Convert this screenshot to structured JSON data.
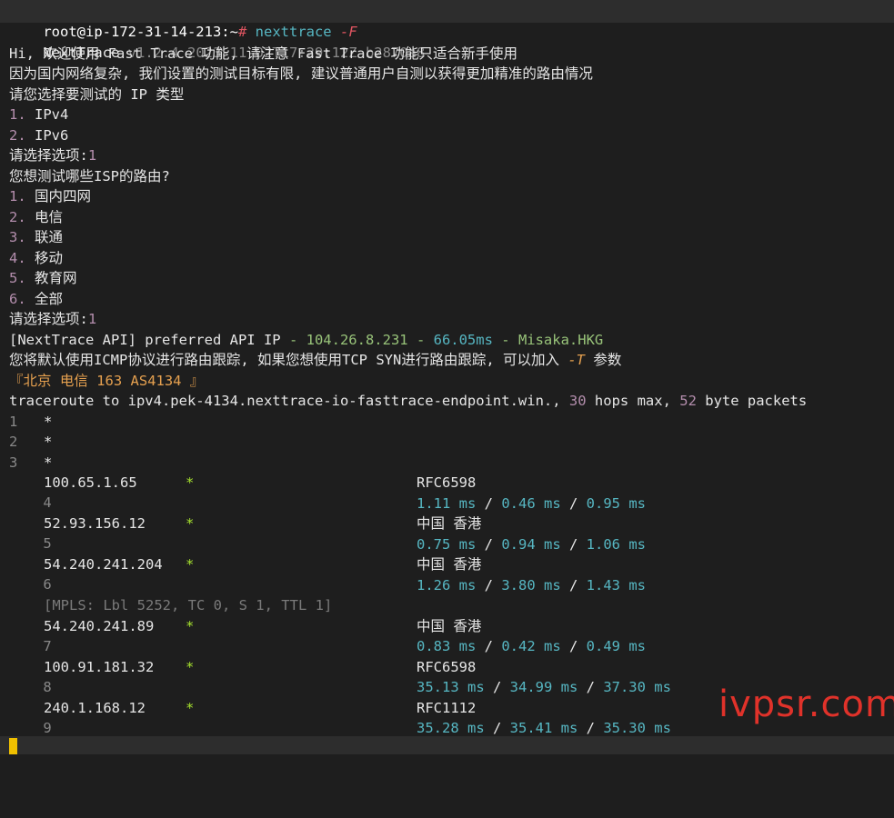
{
  "prompt": {
    "user_host": "root@ip-172-31-14-213:~",
    "symbol": "#",
    "command": "nexttrace",
    "flag": "-F"
  },
  "header": {
    "app": "NextTrace",
    "version": "v1.2.4 2023-11-02T17:29:12Z b2870a8"
  },
  "intro": {
    "l1_a": "Hi, 欢迎使用 ",
    "l1_b": "Fast Trace",
    "l1_c": " 功能, 请注意 ",
    "l1_d": "Fast Trace",
    "l1_e": " 功能只适合新手使用",
    "l2": "因为国内网络复杂, 我们设置的测试目标有限, 建议普通用户自测以获得更加精准的路由情况",
    "l3": "请您选择要测试的 IP 类型"
  },
  "ip_options": [
    {
      "num": "1.",
      "label": "IPv4"
    },
    {
      "num": "2.",
      "label": "IPv6"
    }
  ],
  "choose1": {
    "label": "请选择选项:",
    "value": "1"
  },
  "isp_question": "您想测试哪些ISP的路由?",
  "isp_options": [
    {
      "num": "1.",
      "label": "国内四网"
    },
    {
      "num": "2.",
      "label": "电信"
    },
    {
      "num": "3.",
      "label": "联通"
    },
    {
      "num": "4.",
      "label": "移动"
    },
    {
      "num": "5.",
      "label": "教育网"
    },
    {
      "num": "6.",
      "label": "全部"
    }
  ],
  "choose2": {
    "label": "请选择选项:",
    "value": "1"
  },
  "api": {
    "prefix": "[NextTrace API] preferred API IP",
    "sep1": " - ",
    "ip": "104.26.8.231",
    "sep2": " - ",
    "latency": "66.05ms",
    "sep3": " - ",
    "node": "Misaka.HKG"
  },
  "icmp_note": {
    "text": "您将默认使用ICMP协议进行路由跟踪, 如果您想使用TCP SYN进行路由跟踪, 可以加入 ",
    "flag": "-T",
    "tail": " 参数"
  },
  "target": "『北京 电信 163 AS4134 』",
  "traceroute": {
    "a": "traceroute to ipv4.pek-4134.nexttrace-io-fasttrace-endpoint.win., ",
    "hops": "30",
    "b": " hops max, ",
    "bytes": "52",
    "c": " byte packets"
  },
  "hops_simple": [
    {
      "num": "1",
      "star": "*"
    },
    {
      "num": "2",
      "star": "*"
    },
    {
      "num": "3",
      "star": "*"
    }
  ],
  "hops": [
    {
      "num": "4",
      "ip": "100.65.1.65",
      "star": "*",
      "geo": "RFC6598",
      "t1": "1.11 ms",
      "t2": "0.46 ms",
      "t3": "0.95 ms"
    },
    {
      "num": "5",
      "ip": "52.93.156.12",
      "star": "*",
      "geo": "中国 香港",
      "t1": "0.75 ms",
      "t2": "0.94 ms",
      "t3": "1.06 ms"
    },
    {
      "num": "6",
      "ip": "54.240.241.204",
      "star": "*",
      "geo": "中国 香港",
      "t1": "1.26 ms",
      "t2": "3.80 ms",
      "t3": "1.43 ms"
    },
    {
      "num": "7",
      "ip": "54.240.241.89",
      "star": "*",
      "geo": "中国 香港",
      "t1": "0.83 ms",
      "t2": "0.42 ms",
      "t3": "0.49 ms"
    },
    {
      "num": "8",
      "ip": "100.91.181.32",
      "star": "*",
      "geo": "RFC6598",
      "t1": "35.13 ms",
      "t2": "34.99 ms",
      "t3": "37.30 ms"
    },
    {
      "num": "9",
      "ip": "240.1.168.12",
      "star": "*",
      "geo": "RFC1112",
      "t1": "35.28 ms",
      "t2": "35.41 ms",
      "t3": "35.30 ms"
    }
  ],
  "mpls": "[MPLS: Lbl 5252, TC 0, S 1, TTL 1]",
  "time_sep": " / ",
  "watermark": "ivpsr.com"
}
